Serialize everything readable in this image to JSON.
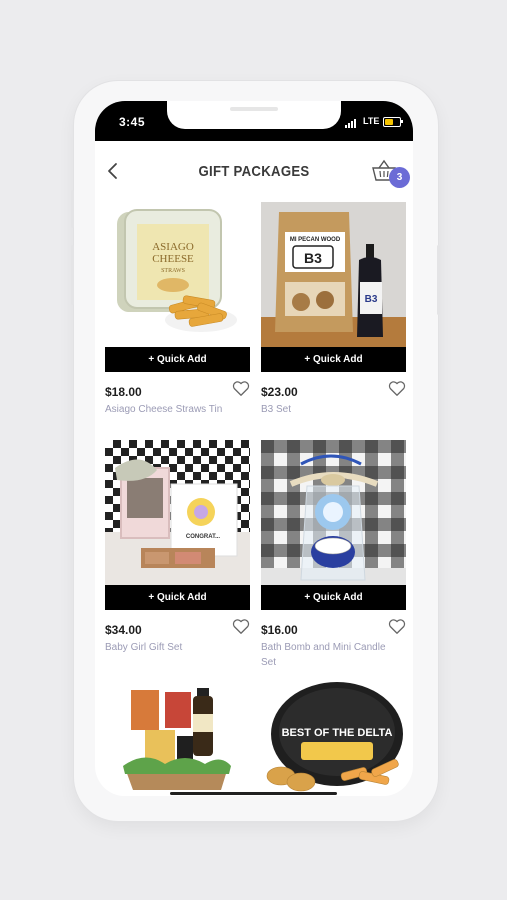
{
  "status_bar": {
    "time": "3:45",
    "network": "LTE",
    "battery_level": 0.55,
    "battery_color": "#f5c400"
  },
  "header": {
    "title": "GIFT PACKAGES",
    "back_icon": "chevron-left-icon",
    "cart_icon": "basket-icon",
    "cart_count": "3",
    "badge_color": "#6b6bd6"
  },
  "products": [
    {
      "price": "$18.00",
      "name": "Asiago Cheese Straws Tin",
      "quick_add": "+ Quick Add",
      "tin_label_1": "ASIAGO",
      "tin_label_2": "CHEESE",
      "tin_label_3": "STRAWS"
    },
    {
      "price": "$23.00",
      "name": "B3 Set",
      "quick_add": "+ Quick Add",
      "bag_label_1": "MI PECAN WOOD",
      "bag_label_2": "B3",
      "bottle_label": "B3"
    },
    {
      "price": "$34.00",
      "name": "Baby Girl Gift Set",
      "quick_add": "+ Quick Add",
      "card_label": "CONGRAT..."
    },
    {
      "price": "$16.00",
      "name": "Bath Bomb and Mini Candle Set",
      "quick_add": "+ Quick Add"
    },
    {
      "tin_label_1": "BEST OF THE DELTA"
    },
    {}
  ]
}
